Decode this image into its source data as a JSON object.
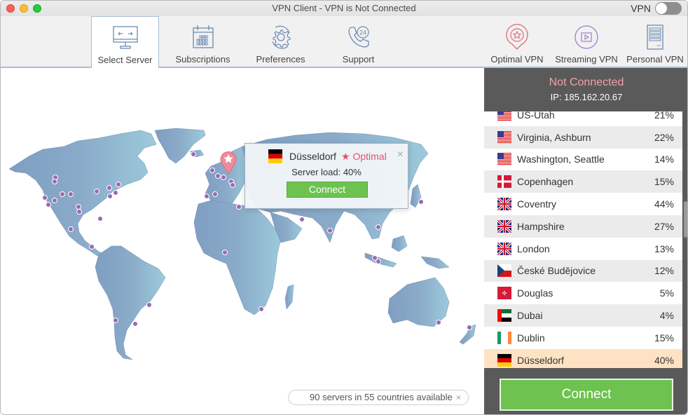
{
  "window": {
    "title": "VPN Client - VPN is Not Connected",
    "vpn_toggle_label": "VPN",
    "vpn_toggle_on": false
  },
  "toolbar": {
    "left_items": [
      {
        "label": "Select Server",
        "icon": "monitor-arrows-icon",
        "active": true
      },
      {
        "label": "Subscriptions",
        "icon": "calendar-icon",
        "active": false
      },
      {
        "label": "Preferences",
        "icon": "gear-refresh-icon",
        "active": false
      },
      {
        "label": "Support",
        "icon": "phone-24-icon",
        "active": false
      }
    ],
    "right_items": [
      {
        "label": "Optimal VPN",
        "icon": "location-star-icon"
      },
      {
        "label": "Streaming VPN",
        "icon": "play-circle-icon"
      },
      {
        "label": "Personal VPN",
        "icon": "server-icon"
      }
    ]
  },
  "map": {
    "popup": {
      "city": "Düsseldorf",
      "flag": "germany-flag",
      "optimal_label": "★ Optimal",
      "server_load": "Server load: 40%",
      "connect_label": "Connect",
      "close_label": "×"
    },
    "status_text": "90 servers in 55 countries available",
    "status_close": "×"
  },
  "panel": {
    "status": "Not Connected",
    "ip": "IP: 185.162.20.67",
    "connect_label": "Connect",
    "servers": [
      {
        "name": "US-Utah",
        "load": "21%",
        "flag": "us"
      },
      {
        "name": "Virginia, Ashburn",
        "load": "22%",
        "flag": "us"
      },
      {
        "name": "Washington, Seattle",
        "load": "14%",
        "flag": "us"
      },
      {
        "name": "Copenhagen",
        "load": "15%",
        "flag": "dk"
      },
      {
        "name": "Coventry",
        "load": "44%",
        "flag": "gb"
      },
      {
        "name": "Hampshire",
        "load": "27%",
        "flag": "gb"
      },
      {
        "name": "London",
        "load": "13%",
        "flag": "gb"
      },
      {
        "name": "České Budějovice",
        "load": "12%",
        "flag": "cz"
      },
      {
        "name": "Douglas",
        "load": "5%",
        "flag": "im"
      },
      {
        "name": "Dubai",
        "load": "4%",
        "flag": "ae"
      },
      {
        "name": "Dublin",
        "load": "15%",
        "flag": "ie"
      },
      {
        "name": "Düsseldorf",
        "load": "40%",
        "flag": "de",
        "selected": true
      }
    ]
  },
  "colors": {
    "not_connected": "#f0a0ac",
    "connect_green": "#6dc250",
    "optimal_red": "#e0546a",
    "map_land": "#8aa8c8",
    "server_dot": "#9a6ab4",
    "selected_row": "#fde2c4"
  }
}
